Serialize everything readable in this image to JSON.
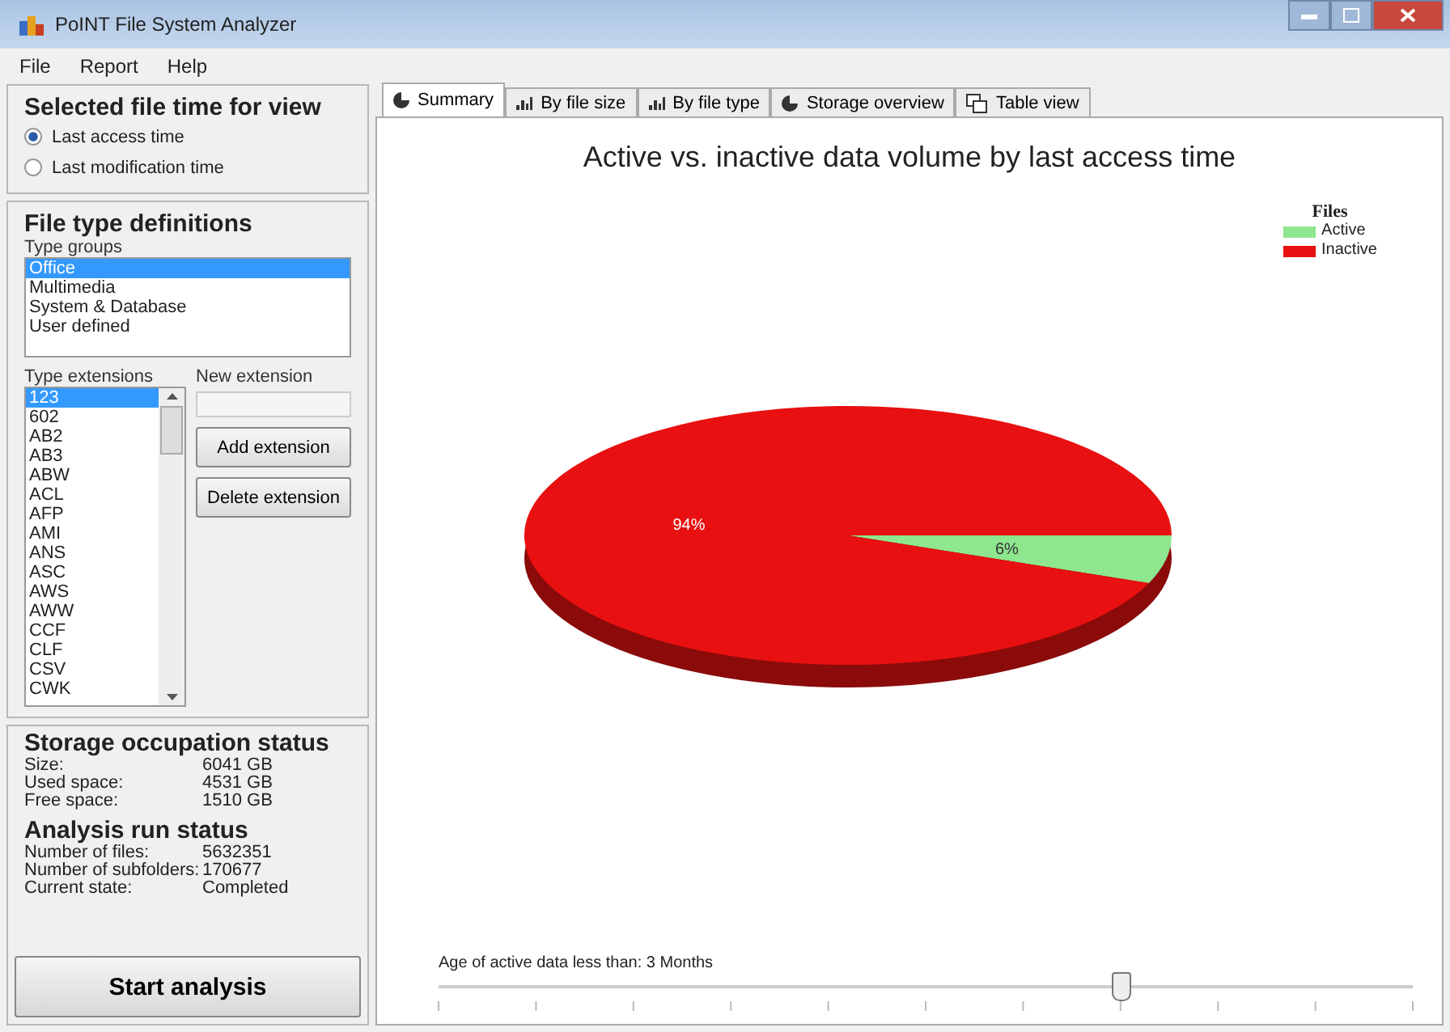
{
  "window": {
    "title": "PoINT File System Analyzer"
  },
  "menu": [
    "File",
    "Report",
    "Help"
  ],
  "file_time": {
    "title": "Selected file time for view",
    "options": [
      {
        "label": "Last access time",
        "selected": true
      },
      {
        "label": "Last modification time",
        "selected": false
      }
    ]
  },
  "file_types": {
    "title": "File type definitions",
    "groups_label": "Type groups",
    "groups": [
      {
        "label": "Office",
        "selected": true
      },
      {
        "label": "Multimedia",
        "selected": false
      },
      {
        "label": "System & Database",
        "selected": false
      },
      {
        "label": "User defined",
        "selected": false
      }
    ],
    "extensions_label": "Type extensions",
    "extensions": [
      {
        "label": "123",
        "selected": true
      },
      {
        "label": "602",
        "selected": false
      },
      {
        "label": "AB2",
        "selected": false
      },
      {
        "label": "AB3",
        "selected": false
      },
      {
        "label": "ABW",
        "selected": false
      },
      {
        "label": "ACL",
        "selected": false
      },
      {
        "label": "AFP",
        "selected": false
      },
      {
        "label": "AMI",
        "selected": false
      },
      {
        "label": "ANS",
        "selected": false
      },
      {
        "label": "ASC",
        "selected": false
      },
      {
        "label": "AWS",
        "selected": false
      },
      {
        "label": "AWW",
        "selected": false
      },
      {
        "label": "CCF",
        "selected": false
      },
      {
        "label": "CLF",
        "selected": false
      },
      {
        "label": "CSV",
        "selected": false
      },
      {
        "label": "CWK",
        "selected": false
      }
    ],
    "new_extension_label": "New extension",
    "buttons": [
      "Add extension",
      "Delete extension"
    ]
  },
  "storage": {
    "title": "Storage occupation status",
    "rows": [
      {
        "label": "Size:",
        "value": "6041 GB"
      },
      {
        "label": "Used space:",
        "value": "4531 GB"
      },
      {
        "label": "Free space:",
        "value": "1510 GB"
      }
    ]
  },
  "analysis": {
    "title": "Analysis run status",
    "rows": [
      {
        "label": "Number of files:",
        "value": "5632351"
      },
      {
        "label": "Number of subfolders:",
        "value": "170677"
      },
      {
        "label": "Current state:",
        "value": "Completed"
      }
    ]
  },
  "start_button": "Start analysis",
  "tabs": [
    {
      "label": "Summary",
      "kind": "pie",
      "selected": true
    },
    {
      "label": "By file size",
      "kind": "bars",
      "selected": false
    },
    {
      "label": "By file type",
      "kind": "bars",
      "selected": false
    },
    {
      "label": "Storage overview",
      "kind": "pie",
      "selected": false
    },
    {
      "label": "Table view",
      "kind": "table",
      "selected": false
    }
  ],
  "chart_data": {
    "type": "pie",
    "title": "Active vs. inactive data volume by last access time",
    "legend_title": "Files",
    "categories": [
      "Active",
      "Inactive"
    ],
    "values": [
      6,
      94
    ],
    "colors": [
      "#8ee68e",
      "#e81010"
    ],
    "value_labels": [
      "6%",
      "94%"
    ]
  },
  "slider": {
    "label": "Age of active data less than: 3 Months",
    "level": 0.7
  }
}
